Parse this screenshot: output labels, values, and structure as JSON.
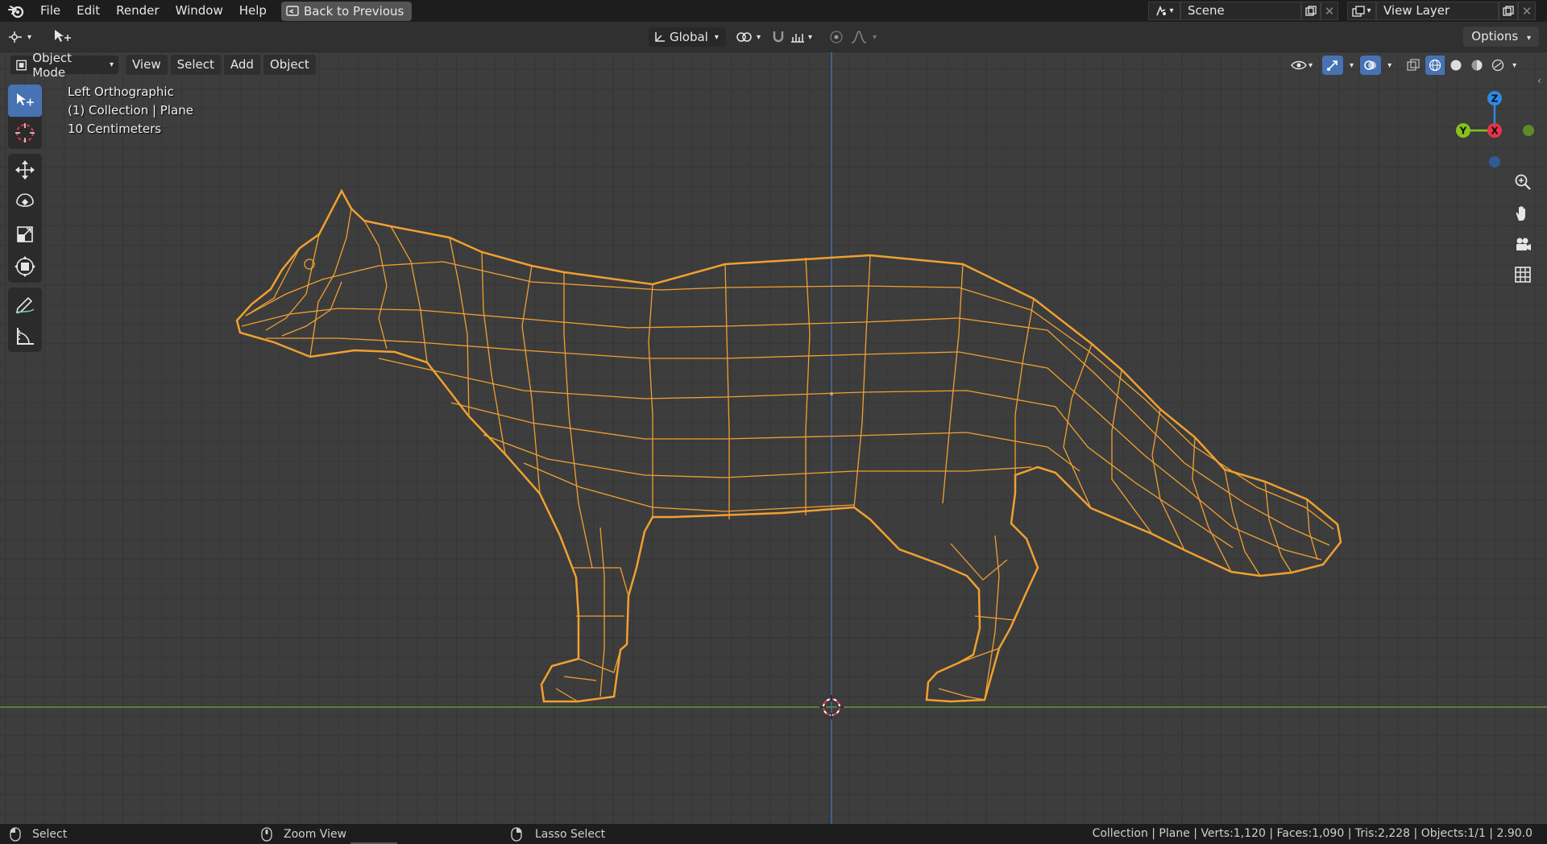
{
  "menubar": {
    "items": [
      "File",
      "Edit",
      "Render",
      "Window",
      "Help"
    ],
    "back_button": "Back to Previous",
    "scene_name": "Scene",
    "view_layer_name": "View Layer"
  },
  "header": {
    "transform_orientation": "Global",
    "options_label": "Options"
  },
  "viewport": {
    "mode_label": "Object Mode",
    "menus": [
      "View",
      "Select",
      "Add",
      "Object"
    ],
    "overlay": {
      "view_name": "Left Orthographic",
      "collection_info": "(1) Collection | Plane",
      "scale_info": "10 Centimeters"
    },
    "gizmo": {
      "z_label": "Z",
      "y_label": "Y",
      "x_label": "X"
    }
  },
  "statusbar": {
    "left_hint": "Select",
    "middle_hint": "Zoom View",
    "right_hint": "Lasso Select",
    "stats": "Collection | Plane | Verts:1,120 | Faces:1,090 | Tris:2,228 | Objects:1/1 | 2.90.0"
  },
  "colors": {
    "accent_blue": "#4772b3",
    "wire_orange": "#f0a030",
    "axis_x": "#e8334a",
    "axis_y": "#84c21c",
    "axis_z": "#2c8ae8",
    "floor_line": "#6b8e3a",
    "vertical_axis": "#3e6ea8"
  }
}
